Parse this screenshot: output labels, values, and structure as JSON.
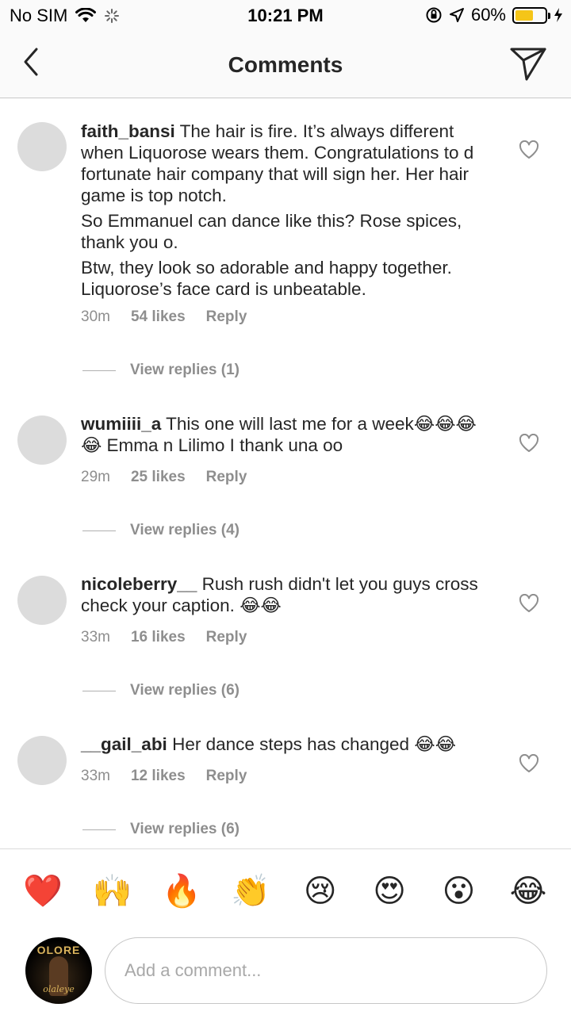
{
  "status_bar": {
    "carrier": "No SIM",
    "time": "10:21 PM",
    "battery": "60%",
    "battery_level": 0.6,
    "battery_color": "#f5c518"
  },
  "header": {
    "title": "Comments",
    "back_icon": "chevron-left-icon",
    "send_icon": "paper-plane-icon"
  },
  "comments": [
    {
      "username": "faith_bansi",
      "paragraphs": [
        "The hair is fire. It’s always different when Liquorose wears them. Congratulations to d fortunate hair company that will sign her. Her hair game is top notch.",
        "So Emmanuel can dance like this? Rose spices, thank you o.",
        "Btw, they look so adorable and happy together. Liquorose’s face card is unbeatable."
      ],
      "time": "30m",
      "likes": "54 likes",
      "reply": "Reply",
      "view_replies": "View replies (1)"
    },
    {
      "username": "wumiiii_a",
      "paragraphs": [
        "This one  will last me for a week😂😂😂😂 Emma n Lilimo I thank una oo"
      ],
      "time": "29m",
      "likes": "25 likes",
      "reply": "Reply",
      "view_replies": "View replies (4)"
    },
    {
      "username": "nicoleberry__",
      "paragraphs": [
        "Rush rush didn't let you guys cross check your caption. 😂😂"
      ],
      "time": "33m",
      "likes": "16 likes",
      "reply": "Reply",
      "view_replies": "View replies (6)"
    },
    {
      "username": "__gail_abi",
      "paragraphs": [
        "Her dance steps has changed 😂😂"
      ],
      "time": "33m",
      "likes": "12 likes",
      "reply": "Reply",
      "view_replies": "View replies (6)"
    }
  ],
  "emoji_bar": [
    "❤️",
    "🙌",
    "🔥",
    "👏",
    "😢",
    "😍",
    "😮",
    "😂"
  ],
  "composer": {
    "placeholder": "Add a comment...",
    "avatar_text": "OLORE",
    "avatar_signature": "olaleye"
  }
}
